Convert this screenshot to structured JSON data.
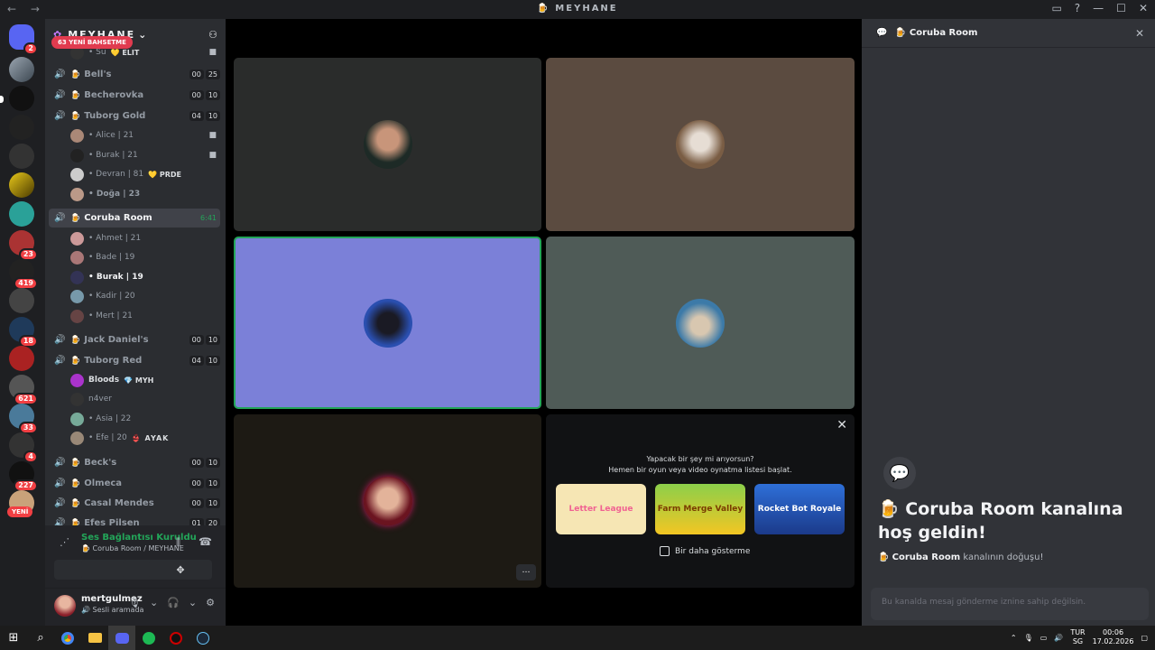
{
  "window": {
    "title": "MEYHANE",
    "nav": "← →"
  },
  "server_list": {
    "home_badge": "2",
    "badges": [
      "23",
      "419",
      "18",
      "621",
      "33",
      "4",
      "227"
    ],
    "new_label": "YENİ"
  },
  "server": {
    "name": "MEYHANE",
    "mention_pill": "63 YENİ BAHSETME",
    "top_partial_user": "• Su",
    "top_partial_tag": "💛 ELIT",
    "channels": [
      {
        "name": "Bell's",
        "c1": "00",
        "c2": "25"
      },
      {
        "name": "Becherovka",
        "c1": "00",
        "c2": "10"
      },
      {
        "name": "Tuborg Gold",
        "c1": "04",
        "c2": "10"
      },
      {
        "name": "Coruba Room",
        "time": "6:41"
      },
      {
        "name": "Jack Daniel's",
        "c1": "00",
        "c2": "10"
      },
      {
        "name": "Tuborg Red",
        "c1": "04",
        "c2": "10"
      },
      {
        "name": "Beck's",
        "c1": "00",
        "c2": "10"
      },
      {
        "name": "Olmeca",
        "c1": "00",
        "c2": "10"
      },
      {
        "name": "Casal Mendes",
        "c1": "00",
        "c2": "10"
      },
      {
        "name": "Efes Pilsen",
        "c1": "01",
        "c2": "20"
      }
    ],
    "tuborg_gold_users": [
      {
        "name": "• Alice | 21",
        "tag": ""
      },
      {
        "name": "• Burak | 21",
        "tag": ""
      },
      {
        "name": "• Devran | 81",
        "tag": "💛 PRDE"
      },
      {
        "name": "• Doğa | 23",
        "tag": ""
      }
    ],
    "coruba_users": [
      {
        "name": "• Ahmet | 21"
      },
      {
        "name": "• Bade | 19"
      },
      {
        "name": "• Burak | 19"
      },
      {
        "name": "• Kadir | 20"
      },
      {
        "name": "• Mert | 21"
      }
    ],
    "tuborg_red_users": [
      {
        "name": "Bloods",
        "tag": "💎 MYH"
      },
      {
        "name": "n4ver",
        "tag": ""
      },
      {
        "name": "• Asia | 22",
        "tag": ""
      },
      {
        "name": "• Efe | 20",
        "tag": "👙 AYAK"
      }
    ]
  },
  "voice": {
    "status": "Ses Bağlantısı Kuruldu",
    "location": "Coruba Room / MEYHANE"
  },
  "user": {
    "name": "mertgulmez",
    "status": "Sesli aramada"
  },
  "activity": {
    "question": "Yapacak bir şey mi arıyorsun?",
    "hint": "Hemen bir oyun veya video oynatma listesi başlat.",
    "games": [
      "Letter League",
      "Farm Merge Valley",
      "Rocket Bot Royale"
    ],
    "dont_show": "Bir daha gösterme"
  },
  "chat": {
    "header": "Coruba Room",
    "welcome": "🍺 Coruba Room kanalına hoş geldin!",
    "start_prefix": "🍺",
    "start_channel": "Coruba Room",
    "start_suffix": "kanalının doğuşu!",
    "placeholder": "Bu kanalda mesaj gönderme iznine sahip değilsin."
  },
  "taskbar": {
    "lang": "TUR",
    "lang2": "SG",
    "time": "00:06",
    "date": "17.02.2026"
  },
  "colors": {
    "accent": "#5865f2",
    "green": "#23a559",
    "red": "#f23f43",
    "speaking_tile": "#7b80d8"
  }
}
